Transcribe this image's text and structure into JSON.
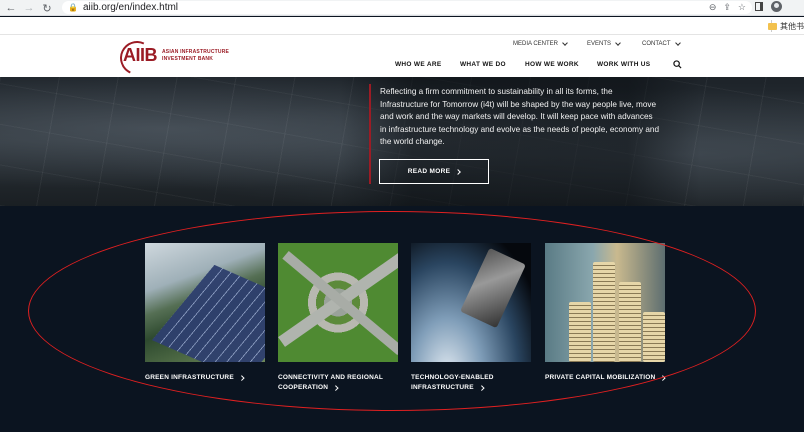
{
  "browser": {
    "url": "aiib.org/en/index.html",
    "bookmarks_folder": "其他书"
  },
  "header": {
    "logo_mark": "AIIB",
    "logo_line1": "ASIAN INFRASTRUCTURE",
    "logo_line2": "INVESTMENT BANK",
    "utility": [
      "MEDIA CENTER",
      "EVENTS",
      "CONTACT"
    ],
    "nav": [
      "WHO WE ARE",
      "WHAT WE DO",
      "HOW WE WORK",
      "WORK WITH US"
    ]
  },
  "hero": {
    "text": "Reflecting a firm commitment to sustainability in all its forms, the Infrastructure for Tomorrow (i4t) will be shaped by the way people live, move and work and the way markets will develop. It will keep pace with advances in infrastructure technology and evolve as the needs of people, economy and the world change.",
    "button": "READ MORE"
  },
  "cards": [
    {
      "label": "GREEN INFRASTRUCTURE",
      "image": "solar-panels-image"
    },
    {
      "label": "CONNECTIVITY AND REGIONAL",
      "label2": "COOPERATION",
      "image": "highway-interchange-image"
    },
    {
      "label": "TECHNOLOGY-ENABLED",
      "label2": "INFRASTRUCTURE",
      "image": "satellite-earth-image"
    },
    {
      "label": "PRIVATE CAPITAL MOBILIZATION",
      "image": "coin-stacks-image"
    }
  ],
  "colors": {
    "brand": "#9b1c25",
    "annotation": "#e02020",
    "background": "#0b1420"
  }
}
